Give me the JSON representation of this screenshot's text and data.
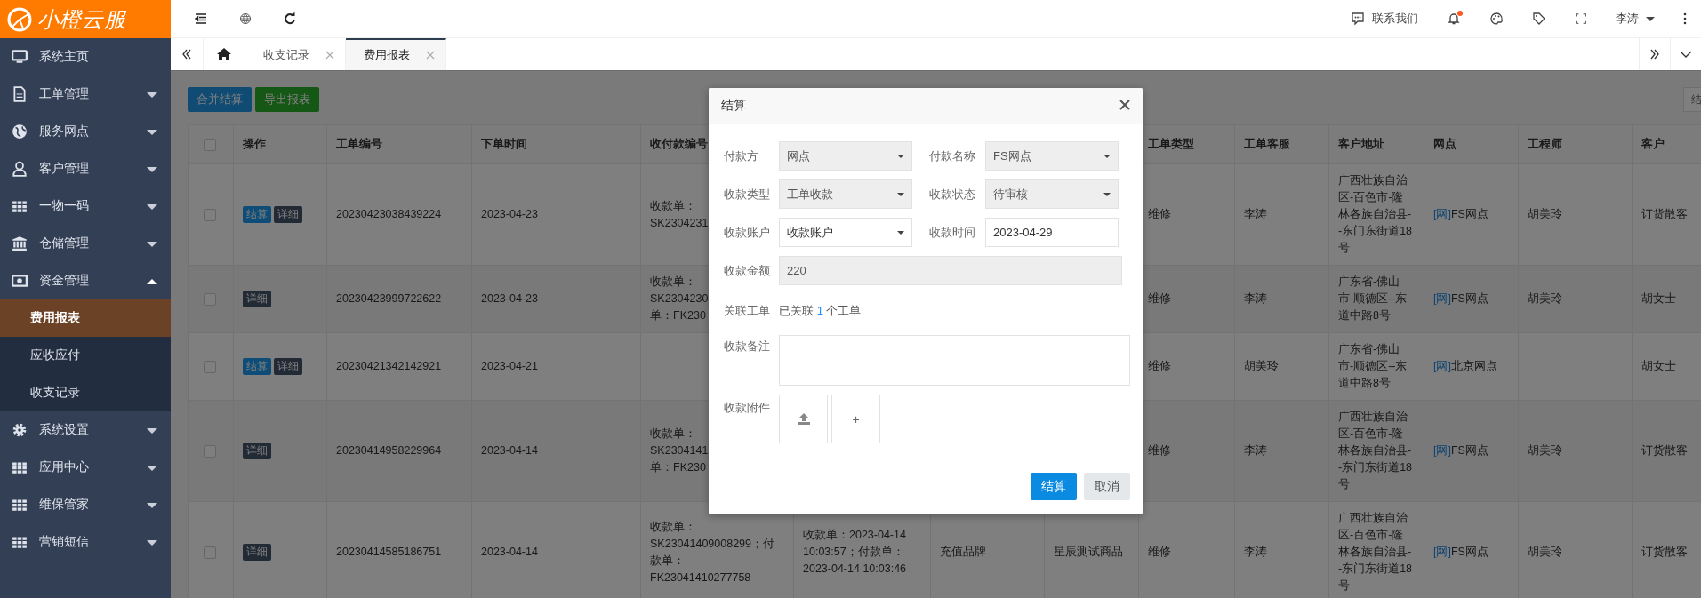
{
  "brand": {
    "name": "小橙云服"
  },
  "sidebar": {
    "items": [
      {
        "label": "系统主页"
      },
      {
        "label": "工单管理",
        "expanded": false
      },
      {
        "label": "服务网点",
        "expanded": false
      },
      {
        "label": "客户管理",
        "expanded": false
      },
      {
        "label": "一物一码",
        "expanded": false
      },
      {
        "label": "仓储管理",
        "expanded": false
      },
      {
        "label": "资金管理",
        "expanded": true,
        "children": [
          {
            "label": "费用报表",
            "selected": true
          },
          {
            "label": "应收应付",
            "selected": false
          },
          {
            "label": "收支记录",
            "selected": false
          }
        ]
      },
      {
        "label": "系统设置",
        "expanded": false
      },
      {
        "label": "应用中心",
        "expanded": false
      },
      {
        "label": "维保管家",
        "expanded": false
      },
      {
        "label": "营销短信",
        "expanded": false
      }
    ]
  },
  "header": {
    "contact": "联系我们",
    "notifications": {
      "unread": true
    },
    "user": "李涛"
  },
  "tabs": [
    {
      "label": "收支记录",
      "selected": false
    },
    {
      "label": "费用报表",
      "selected": true
    }
  ],
  "toolbar": {
    "buttons": [
      {
        "label": "合并结算",
        "kind": "primary"
      },
      {
        "label": "导出报表",
        "kind": "success"
      }
    ],
    "right_button": "结"
  },
  "table": {
    "columns": [
      {
        "kind": "checkbox",
        "checked": false
      },
      {
        "label": "操作"
      },
      {
        "label": "工单编号"
      },
      {
        "label": "下单时间"
      },
      {
        "label": "收付款编号"
      },
      null,
      null,
      null,
      {
        "label": "工单类型"
      },
      {
        "label": "工单客服"
      },
      {
        "label": "客户地址"
      },
      {
        "label": "网点"
      },
      {
        "label": "工程师"
      },
      {
        "label": "客户"
      }
    ],
    "rows": [
      {
        "cells": [
          {
            "kind": "checkbox",
            "checked": false
          },
          {
            "kind": "actions",
            "buttons": [
              {
                "label": "结算",
                "kind": "settle"
              },
              {
                "label": "详细",
                "kind": "detail"
              }
            ]
          },
          "20230423038439224",
          "2023-04-23",
          "收款单：\nSK2304231",
          null,
          null,
          null,
          "维修",
          "李涛",
          "广西壮族自治区-百色市-隆林各族自治县--东门东街道18号",
          {
            "tag": "[网]",
            "text": "FS网点"
          },
          "胡美玲",
          "订货散客"
        ]
      },
      {
        "cells": [
          {
            "kind": "checkbox",
            "checked": false
          },
          {
            "kind": "actions",
            "buttons": [
              {
                "label": "详细",
                "kind": "detail"
              }
            ]
          },
          "20230423999722622",
          "2023-04-23",
          "收款单：\nSK2304230\n单：FK230",
          null,
          null,
          null,
          "维修",
          "李涛",
          "广东省-佛山市-顺德区--东道中路8号",
          {
            "tag": "[网]",
            "text": "FS网点"
          },
          "胡美玲",
          "胡女士"
        ]
      },
      {
        "cells": [
          {
            "kind": "checkbox",
            "checked": false
          },
          {
            "kind": "actions",
            "buttons": [
              {
                "label": "结算",
                "kind": "settle"
              },
              {
                "label": "详细",
                "kind": "detail"
              }
            ]
          },
          "20230421342142921",
          "2023-04-21",
          null,
          null,
          null,
          null,
          "维修",
          "胡美玲",
          "广东省-佛山市-顺德区--东道中路8号",
          {
            "tag": "[网]",
            "text": "北京网点"
          },
          null,
          "胡女士"
        ]
      },
      {
        "cells": [
          {
            "kind": "checkbox",
            "checked": false
          },
          {
            "kind": "actions",
            "buttons": [
              {
                "label": "详细",
                "kind": "detail"
              }
            ]
          },
          "20230414958229964",
          "2023-04-14",
          "收款单：\nSK2304141\n单：FK230",
          null,
          null,
          null,
          "维修",
          "李涛",
          "广西壮族自治区-百色市-隆林各族自治县--东门东街道18号",
          {
            "tag": "[网]",
            "text": "FS网点"
          },
          "胡美玲",
          "订货散客"
        ]
      },
      {
        "cells": [
          {
            "kind": "checkbox",
            "checked": false
          },
          {
            "kind": "actions",
            "buttons": [
              {
                "label": "详细",
                "kind": "detail"
              }
            ]
          },
          "20230414585186751",
          "2023-04-14",
          "收款单：SK23041409008299；付款单：FK23041410277758",
          "收款单：2023-04-14 10:03:57；付款单：2023-04-14 10:03:46",
          "充值品牌",
          "星辰测试商品",
          "维修",
          "李涛",
          "广西壮族自治区-百色市-隆林各族自治县--东门东街道18号",
          {
            "tag": "[网]",
            "text": "FS网点"
          },
          "胡美玲",
          "订货散客"
        ]
      }
    ]
  },
  "dialog": {
    "title": "结算",
    "fields": [
      {
        "label": "付款方",
        "kind": "select",
        "value": "网点",
        "disabled": true
      },
      {
        "label": "付款名称",
        "kind": "select",
        "value": "FS网点",
        "disabled": true
      },
      {
        "label": "收款类型",
        "kind": "select",
        "value": "工单收款",
        "disabled": true
      },
      {
        "label": "收款状态",
        "kind": "select",
        "value": "待审核",
        "disabled": true
      },
      {
        "label": "收款账户",
        "kind": "select",
        "value": "收款账户",
        "disabled": false
      },
      {
        "label": "收款时间",
        "kind": "input",
        "value": "2023-04-29",
        "disabled": false
      },
      {
        "label": "收款金额",
        "kind": "input",
        "value": "220",
        "disabled": true
      }
    ],
    "linked": {
      "label": "关联工单",
      "prefix": "已关联",
      "count": "1",
      "suffix": "个工单"
    },
    "remark": {
      "label": "收款备注"
    },
    "attachment": {
      "label": "收款附件",
      "add": "+"
    },
    "buttons": [
      {
        "label": "结算",
        "kind": "primary"
      },
      {
        "label": "取消",
        "kind": "default"
      }
    ]
  }
}
